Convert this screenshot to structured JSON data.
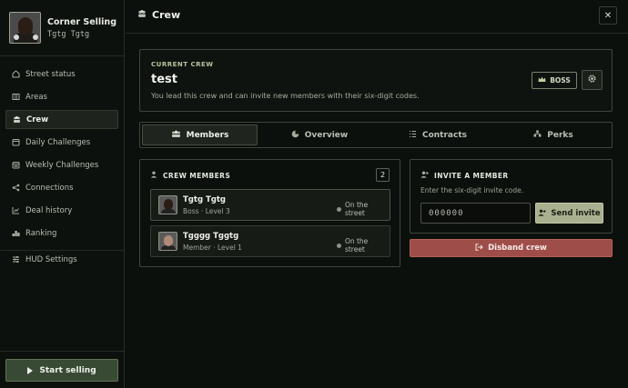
{
  "profile": {
    "name": "Corner Selling",
    "handle": "Tgtg Tgtg"
  },
  "sidebar": {
    "items": [
      {
        "label": "Street status",
        "icon": "pulse-icon"
      },
      {
        "label": "Areas",
        "icon": "map-icon"
      },
      {
        "label": "Crew",
        "icon": "crew-icon",
        "active": true
      },
      {
        "label": "Daily Challenges",
        "icon": "calendar-icon"
      },
      {
        "label": "Weekly Challenges",
        "icon": "calendar-week-icon"
      },
      {
        "label": "Connections",
        "icon": "share-icon"
      },
      {
        "label": "Deal history",
        "icon": "chart-icon"
      },
      {
        "label": "Ranking",
        "icon": "ranking-icon"
      }
    ],
    "settings_label": "HUD Settings",
    "start_label": "Start selling"
  },
  "header": {
    "title": "Crew",
    "close_label": "✕"
  },
  "crew": {
    "label": "CURRENT CREW",
    "name": "test",
    "description": "You lead this crew and can invite new members with their six-digit codes.",
    "role_badge": "BOSS"
  },
  "tabs": [
    {
      "label": "Members",
      "icon": "members-icon",
      "active": true
    },
    {
      "label": "Overview",
      "icon": "pie-icon"
    },
    {
      "label": "Contracts",
      "icon": "list-icon"
    },
    {
      "label": "Perks",
      "icon": "perks-icon"
    }
  ],
  "members_panel": {
    "title": "CREW MEMBERS",
    "count": "2",
    "members": [
      {
        "name": "Tgtg Tgtg",
        "role": "Boss · Level 3",
        "status": "On the street"
      },
      {
        "name": "Tgggg Tggtg",
        "role": "Member · Level 1",
        "status": "On the street"
      }
    ]
  },
  "invite": {
    "title": "INVITE A MEMBER",
    "description": "Enter the six-digit invite code.",
    "placeholder": "000000",
    "send_label": "Send invite",
    "disband_label": "Disband crew"
  },
  "colors": {
    "accent": "#a9b08f",
    "danger": "#9e4d48",
    "start": "#384a34"
  }
}
